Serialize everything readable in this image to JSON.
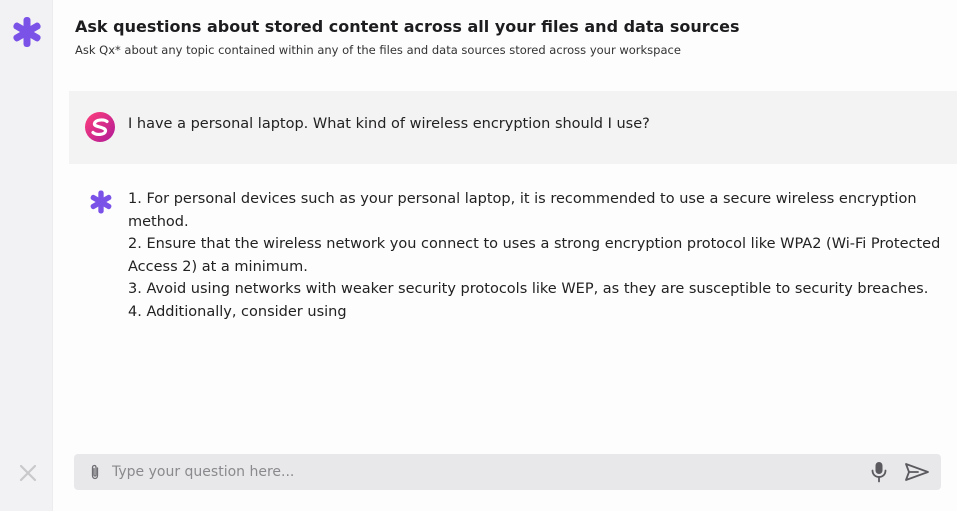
{
  "header": {
    "title": "Ask questions about stored content across all your files and data sources",
    "subtitle": "Ask Qx* about any topic contained within any of the files and data sources stored across your workspace"
  },
  "conversation": {
    "user_message": "I have a personal laptop. What kind of wireless encryption should I use?",
    "assistant_lines": [
      "1. For personal devices such as your personal laptop, it is recommended to use a secure wireless encryption method.",
      "2. Ensure that the wireless network you connect to uses a strong encryption protocol like WPA2 (Wi-Fi Protected Access 2) at a minimum.",
      "3. Avoid using networks with weaker security protocols like WEP, as they are susceptible to security breaches.",
      "4. Additionally, consider using"
    ]
  },
  "composer": {
    "placeholder": "Type your question here...",
    "value": ""
  },
  "icons": {
    "app_logo": "asterisk-icon",
    "close": "close-icon",
    "user_avatar": "user-avatar-icon",
    "assistant_avatar": "asterisk-icon",
    "attach": "paperclip-icon",
    "mic": "microphone-icon",
    "send": "send-icon"
  },
  "colors": {
    "brand": "#7b52e8",
    "user_avatar_start": "#ff3f7a",
    "user_avatar_end": "#b01a98",
    "rail_bg": "#f2f2f4",
    "user_msg_bg": "#f4f3f4",
    "composer_bg": "#e8e8ea"
  }
}
